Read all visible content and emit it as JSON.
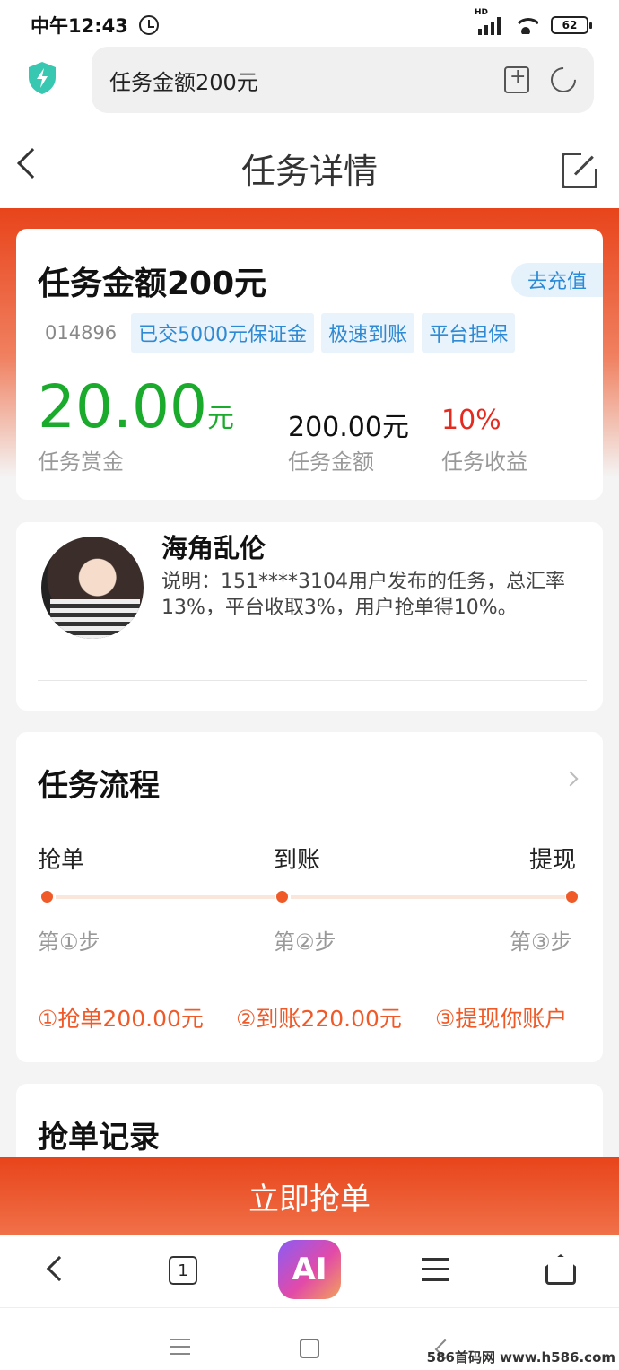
{
  "status_bar": {
    "time": "中午12:43",
    "hd": "HD",
    "battery": "62"
  },
  "browser": {
    "url_text": "任务金额200元"
  },
  "header": {
    "title": "任务详情"
  },
  "task": {
    "title": "任务金额200元",
    "recharge_label": "去充值",
    "code": "014896",
    "tags": [
      "已交5000元保证金",
      "极速到账",
      "平台担保"
    ],
    "reward_value": "20.00",
    "reward_unit": "元",
    "reward_label": "任务赏金",
    "amount_value": "200.00元",
    "amount_label": "任务金额",
    "rate_value": "10%",
    "rate_label": "任务收益"
  },
  "publisher": {
    "name": "海角乱伦",
    "description": "说明：151****3104用户发布的任务，总汇率13%，平台收取3%，用户抢单得10%。"
  },
  "flow": {
    "title": "任务流程",
    "steps": [
      {
        "name": "抢单",
        "no": "第①步"
      },
      {
        "name": "到账",
        "no": "第②步"
      },
      {
        "name": "提现",
        "no": "第③步"
      }
    ],
    "details": [
      "①抢单200.00元",
      "②到账220.00元",
      "③提现你账户"
    ]
  },
  "records": {
    "title": "抢单记录"
  },
  "action": {
    "grab_label": "立即抢单"
  },
  "bottom_nav": {
    "tab_count": "1",
    "ai_label": "AI"
  },
  "watermark": "586首码网 www.h586.com",
  "colors": {
    "accent": "#e8441b",
    "reward_green": "#1bab2c",
    "rate_red": "#e52b1f",
    "tag_blue": "#2f8ad4"
  }
}
